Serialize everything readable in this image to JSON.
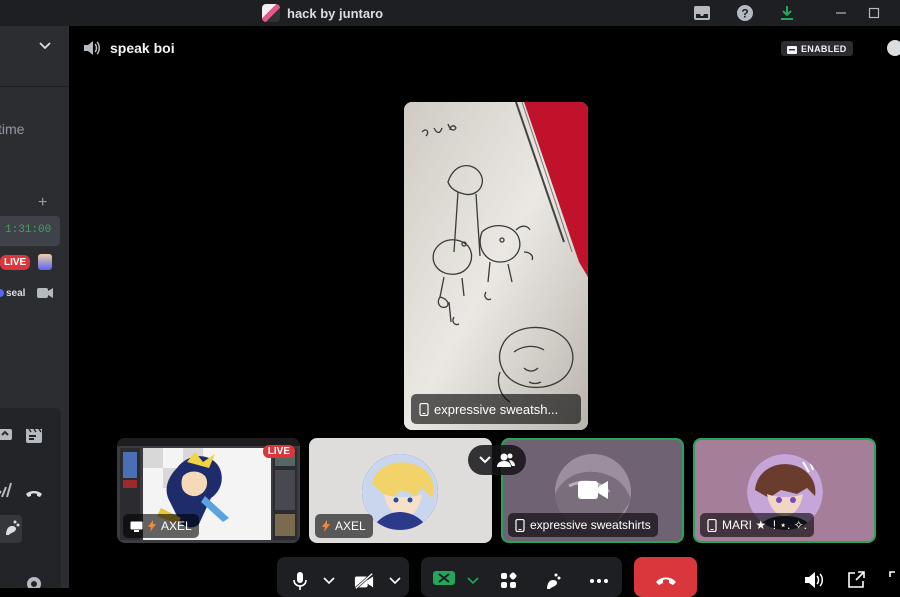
{
  "titlebar": {
    "title": "hack by juntaro",
    "icons": [
      "inbox-icon",
      "help-icon",
      "download-icon",
      "minimize-icon",
      "maximize-icon"
    ]
  },
  "sidebar": {
    "time_word": "time",
    "timer": "1:31:00",
    "live_badge": "LIVE",
    "seal_user": "seal"
  },
  "channel": {
    "name": "speak boi",
    "activity_badge": "ENABLED"
  },
  "main_stream": {
    "label": "expressive sweatsh..."
  },
  "participants": [
    {
      "name": "AXEL",
      "type": "stream",
      "live": true,
      "badge": "LIVE"
    },
    {
      "name": "AXEL",
      "type": "avatar"
    },
    {
      "name": "expressive sweatshirts",
      "type": "camera"
    },
    {
      "name": "MARI ★ ️ ! ⋆. ✧.",
      "type": "avatar"
    }
  ],
  "colors": {
    "accent_green": "#23a55a",
    "live_red": "#da373c",
    "sidebar_bg": "#2b2d31",
    "titlebar_bg": "#1e1f22",
    "timer_green": "#43a25a"
  }
}
